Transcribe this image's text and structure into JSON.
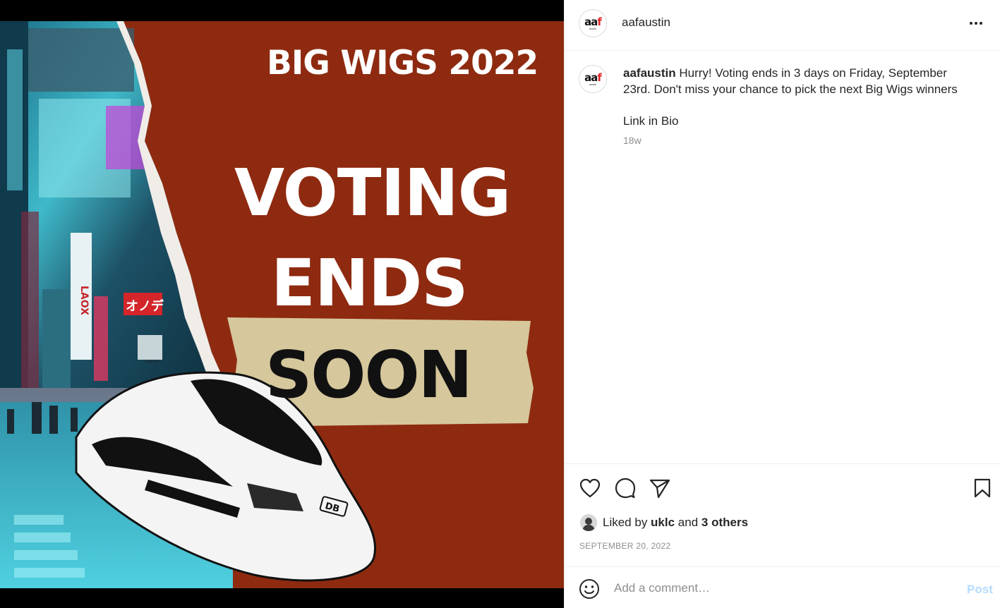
{
  "image": {
    "title": "BIG WIGS 2022",
    "line1": "VOTING",
    "line2": "ENDS",
    "line3": "SOON",
    "train_badge": "DB",
    "sign_laox": "LAOX",
    "sign_onoda": "オノデ",
    "sign_tokyo": "TOKYO",
    "colors": {
      "background": "#8e2a10",
      "tape": "#d6c79c"
    }
  },
  "header": {
    "avatar": {
      "mark_left": "aa",
      "mark_right": "f",
      "sub": "austin"
    },
    "username": "aafaustin",
    "more_icon": "more-horizontal-icon"
  },
  "caption": {
    "username": "aafaustin",
    "text": " Hurry! Voting ends in 3 days on Friday, September 23rd. Don't miss your chance to pick the next Big Wigs winners",
    "extra": "Link in Bio",
    "time": "18w"
  },
  "actions": {
    "like_icon": "heart-icon",
    "comment_icon": "comment-icon",
    "share_icon": "send-icon",
    "save_icon": "bookmark-icon"
  },
  "likes": {
    "prefix": "Liked by ",
    "user": "uklc",
    "middle": " and ",
    "others": "3 others"
  },
  "date": "SEPTEMBER 20, 2022",
  "comment": {
    "placeholder": "Add a comment…",
    "post_label": "Post",
    "emoji_icon": "smiley-icon"
  }
}
